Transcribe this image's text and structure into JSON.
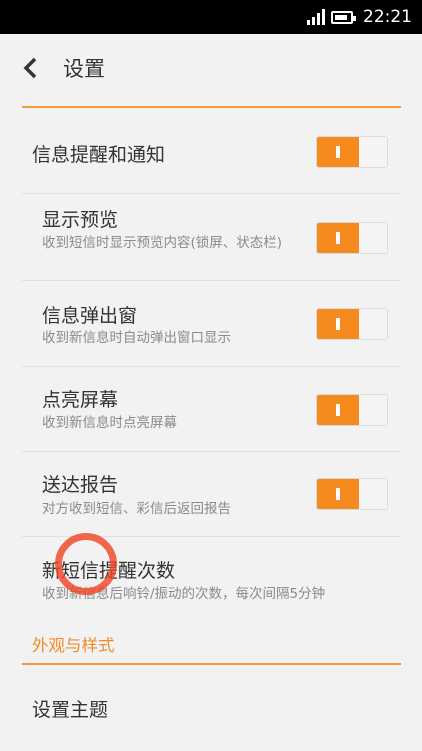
{
  "status_bar": {
    "time": "22:21",
    "signal_level": 4,
    "battery_level": 0.85
  },
  "header": {
    "title": "设置"
  },
  "settings": [
    {
      "title": "信息提醒和通知",
      "subtitle": "",
      "toggle_on": true
    },
    {
      "title": "显示预览",
      "subtitle": "收到短信时显示预览内容(锁屏、状态栏)",
      "toggle_on": true
    },
    {
      "title": "信息弹出窗",
      "subtitle": "收到新信息时自动弹出窗口显示",
      "toggle_on": true
    },
    {
      "title": "点亮屏幕",
      "subtitle": "收到新信息时点亮屏幕",
      "toggle_on": true
    },
    {
      "title": "送达报告",
      "subtitle": "对方收到短信、彩信后返回报告",
      "toggle_on": true
    },
    {
      "title": "新短信提醒次数",
      "subtitle": "收到新信息后响铃/振动的次数，每次间隔5分钟"
    }
  ],
  "section_appearance": {
    "label": "外观与样式"
  },
  "theme_item": {
    "title": "设置主题"
  },
  "colors": {
    "accent": "#f58a1f",
    "divider_accent": "#f29a38"
  }
}
